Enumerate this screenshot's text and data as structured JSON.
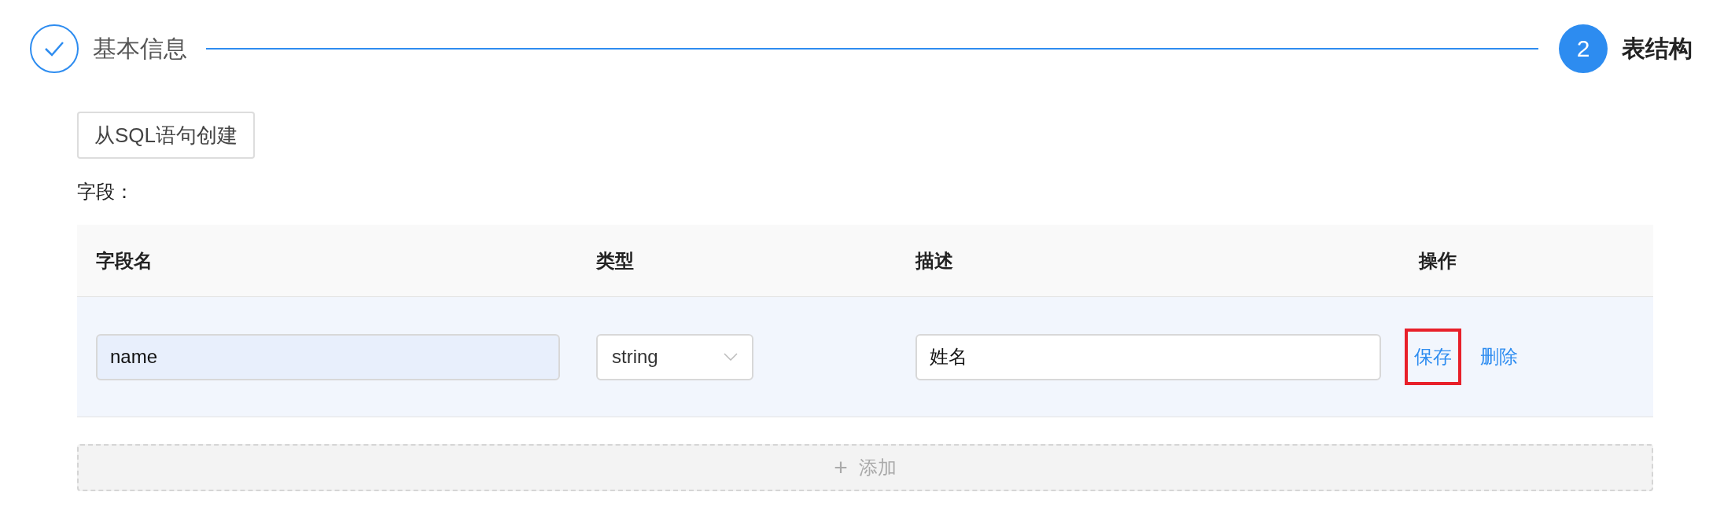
{
  "steps": [
    {
      "kind": "done",
      "title": "基本信息"
    },
    {
      "kind": "current",
      "number": "2",
      "title": "表结构"
    }
  ],
  "sql_button": "从SQL语句创建",
  "fields_label": "字段：",
  "table": {
    "columns": [
      "字段名",
      "类型",
      "描述",
      "操作"
    ],
    "rows": [
      {
        "name": "name",
        "name_focused": true,
        "type": "string",
        "description": "姓名",
        "actions": [
          {
            "label": "保存",
            "highlighted": true
          },
          {
            "label": "删除",
            "highlighted": false
          }
        ]
      }
    ]
  },
  "add_button": {
    "icon": "+",
    "label": "添加"
  }
}
